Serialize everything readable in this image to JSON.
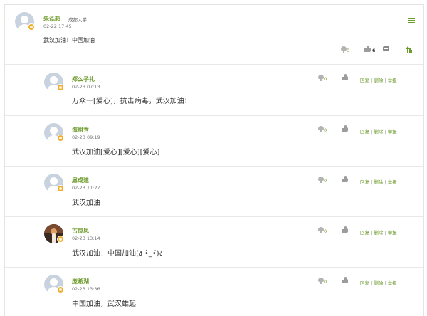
{
  "post": {
    "author": "朱泓超",
    "school": "成都大学",
    "time": "02-22 17:45",
    "content": "武汉加油！中国加油",
    "flower_count": "0",
    "like_count": "6"
  },
  "reply_actions": {
    "reply": "回复",
    "delete": "删除",
    "report": "举报",
    "separator": "|"
  },
  "replies": [
    {
      "author": "郑么子扎",
      "time": "02-23 07:13",
      "content": "万众一[爱心]，抗击病毒，武汉加油！",
      "flower_count": "0",
      "avatar": "default"
    },
    {
      "author": "海租秀",
      "time": "02-23 09:19",
      "content": "武汉加油[爱心][爱心][爱心]",
      "flower_count": "0",
      "avatar": "default"
    },
    {
      "author": "扈成建",
      "time": "02-23 11:27",
      "content": "武汉加油",
      "flower_count": "0",
      "avatar": "default"
    },
    {
      "author": "古良凤",
      "time": "02-23 13:14",
      "content": "武汉加油！中国加油(ง •̀_•́)ง",
      "flower_count": "0",
      "avatar": "photo"
    },
    {
      "author": "庞希湖",
      "time": "02-23 13:36",
      "content": "中国加油，武汉雄起",
      "flower_count": "0",
      "avatar": "default"
    }
  ],
  "colors": {
    "accent": "#6d9b2c",
    "badge": "#f0ad2e",
    "avatar_bg": "#c9d3e0",
    "icon_gray": "#9c9c9c"
  },
  "icons": {
    "menu": "menu-icon",
    "flower": "flower-icon",
    "like": "thumbs-up-icon",
    "comment": "comment-icon",
    "top": "pin-to-top-icon",
    "badge": "verified-badge-icon"
  }
}
